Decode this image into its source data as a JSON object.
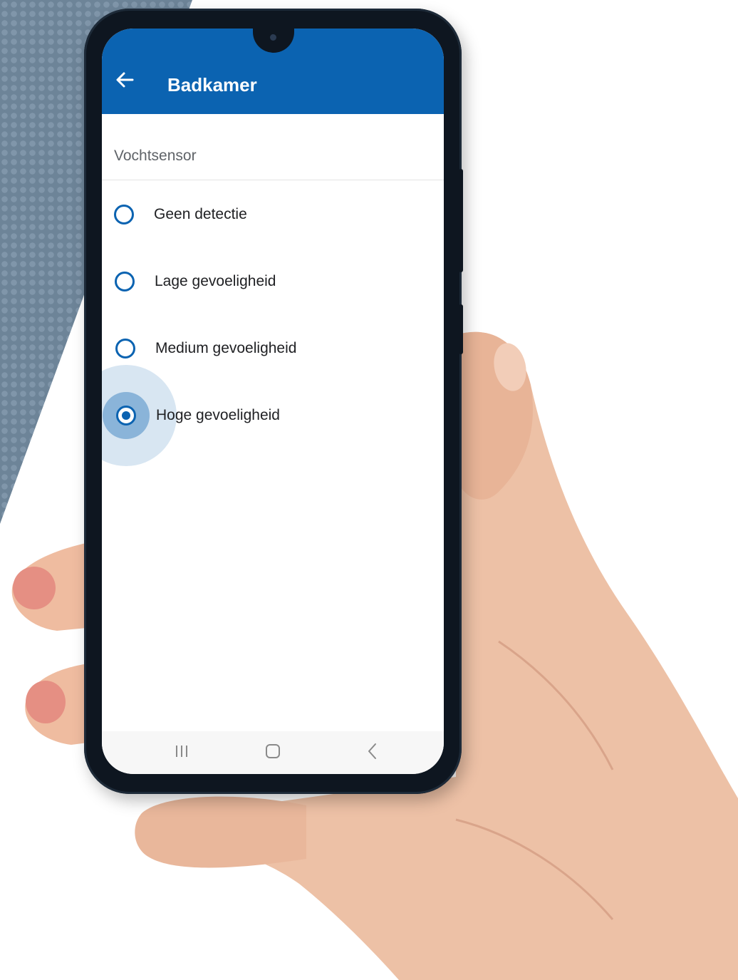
{
  "appbar": {
    "title": "Badkamer",
    "back_icon": "arrow-left-icon"
  },
  "section": {
    "label": "Vochtsensor"
  },
  "options": [
    {
      "label": "Geen detectie",
      "selected": false
    },
    {
      "label": "Lage gevoeligheid",
      "selected": false
    },
    {
      "label": "Medium gevoeligheid",
      "selected": false
    },
    {
      "label": "Hoge gevoeligheid",
      "selected": true
    }
  ],
  "navbar": {
    "recents_icon": "recents-icon",
    "home_icon": "home-icon",
    "back_icon": "nav-back-icon"
  },
  "colors": {
    "accent": "#0b63b1",
    "background_stripe": "#6f8aa3"
  }
}
